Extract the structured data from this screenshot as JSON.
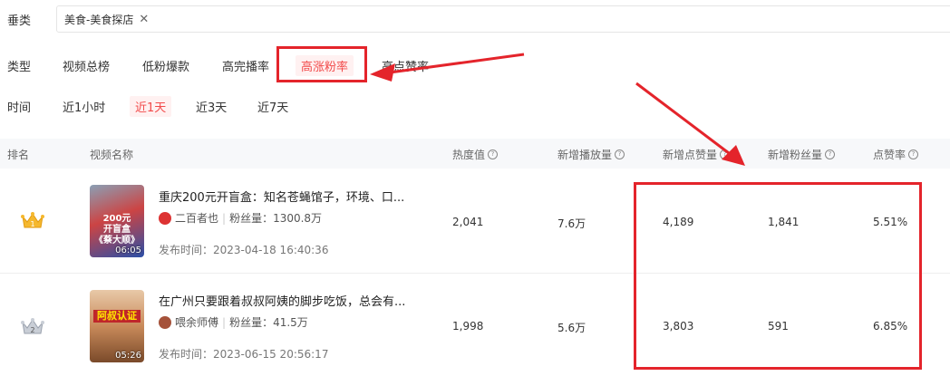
{
  "filters": {
    "category_label": "垂类",
    "category_tag": "美食-美食探店",
    "type_label": "类型",
    "type_options": [
      "视频总榜",
      "低粉爆款",
      "高完播率",
      "高涨粉率",
      "高点赞率"
    ],
    "time_label": "时间",
    "time_options": [
      "近1小时",
      "近1天",
      "近3天",
      "近7天"
    ]
  },
  "table": {
    "headers": {
      "rank": "排名",
      "name": "视频名称",
      "heat": "热度值",
      "plays": "新增播放量",
      "likes": "新增点赞量",
      "fans": "新增粉丝量",
      "like_rate": "点赞率"
    },
    "rows": [
      {
        "rank": "1",
        "title": "重庆200元开盲盒：知名苍蝇馆子，环境、口...",
        "author": "二百者也",
        "fans_label": "粉丝量：1300.8万",
        "date": "发布时间：2023-04-18 16:40:36",
        "duration": "06:05",
        "thumb_text": "200元\n开盲盒\n《蔡大顺》",
        "heat": "2,041",
        "plays": "7.6万",
        "likes": "4,189",
        "fans": "1,841",
        "like_rate": "5.51%"
      },
      {
        "rank": "2",
        "title": "在广州只要跟着叔叔阿姨的脚步吃饭，总会有...",
        "author": "喂余师傅",
        "fans_label": "粉丝量：41.5万",
        "date": "发布时间：2023-06-15 20:56:17",
        "duration": "05:26",
        "thumb_text": "阿叔认证",
        "heat": "1,998",
        "plays": "5.6万",
        "likes": "3,803",
        "fans": "591",
        "like_rate": "6.85%"
      }
    ]
  },
  "colors": {
    "accent": "#f24a4a",
    "annotation": "#e4242b",
    "header_bg": "#f7f8fa",
    "gold": "#f5b82e",
    "silver": "#b8bec8"
  }
}
